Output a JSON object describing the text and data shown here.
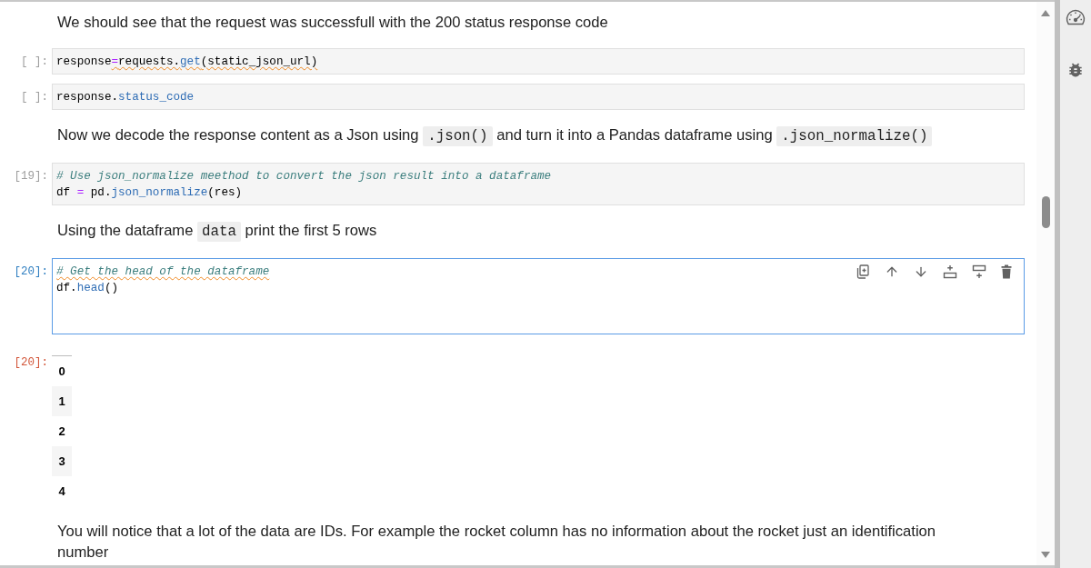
{
  "cells": [
    {
      "kind": "markdown",
      "selected": false,
      "text": [
        {
          "kind": "text",
          "text": "We should see that the request was successfull with the 200 status response code"
        }
      ]
    },
    {
      "kind": "code",
      "selected": false,
      "prompt": "[ ]:",
      "lines": [
        [
          {
            "kind": "plain",
            "text": "response",
            "flagged": false
          },
          {
            "kind": "operator",
            "text": "=",
            "flagged": true
          },
          {
            "kind": "plain",
            "text": "requests.",
            "flagged": true
          },
          {
            "kind": "attribute",
            "text": "get",
            "flagged": true
          },
          {
            "kind": "plain",
            "text": "(static_json_url)",
            "flagged": true
          }
        ]
      ]
    },
    {
      "kind": "code",
      "selected": false,
      "prompt": "[ ]:",
      "lines": [
        [
          {
            "kind": "plain",
            "text": "response.",
            "flagged": false
          },
          {
            "kind": "attribute",
            "text": "status_code",
            "flagged": false
          }
        ]
      ]
    },
    {
      "kind": "markdown",
      "selected": false,
      "text": [
        {
          "kind": "text",
          "text": "Now we decode the response content as a Json using "
        },
        {
          "kind": "code",
          "text": ".json()"
        },
        {
          "kind": "text",
          "text": " and turn it into a Pandas dataframe using "
        },
        {
          "kind": "code",
          "text": ".json_normalize()"
        }
      ]
    },
    {
      "kind": "code",
      "selected": false,
      "prompt": "[19]:",
      "lines": [
        [
          {
            "kind": "comment",
            "text": "# Use json_normalize meethod to convert the json result into a dataframe",
            "flagged": false
          }
        ],
        [
          {
            "kind": "plain",
            "text": "df ",
            "flagged": false
          },
          {
            "kind": "operator",
            "text": "=",
            "flagged": false
          },
          {
            "kind": "plain",
            "text": " pd.",
            "flagged": false
          },
          {
            "kind": "attribute",
            "text": "json_normalize",
            "flagged": false
          },
          {
            "kind": "plain",
            "text": "(res)",
            "flagged": false
          }
        ]
      ]
    },
    {
      "kind": "markdown",
      "selected": false,
      "text": [
        {
          "kind": "text",
          "text": "Using the dataframe "
        },
        {
          "kind": "code",
          "text": "data"
        },
        {
          "kind": "text",
          "text": " print the first 5 rows"
        }
      ]
    },
    {
      "kind": "code",
      "selected": true,
      "prompt": "[20]:",
      "lines": [
        [
          {
            "kind": "comment",
            "text": "# Get the head of the dataframe",
            "flagged": true
          }
        ],
        [
          {
            "kind": "plain",
            "text": "df.",
            "flagged": false
          },
          {
            "kind": "attribute",
            "text": "head",
            "flagged": false
          },
          {
            "kind": "plain",
            "text": "()",
            "flagged": false
          }
        ]
      ],
      "output": {
        "prompt": "[20]:",
        "index": [
          "0",
          "1",
          "2",
          "3",
          "4"
        ]
      }
    },
    {
      "kind": "markdown",
      "selected": false,
      "text": [
        {
          "kind": "text",
          "text": "You will notice that a lot of the data are IDs. For example the rocket column has no information about the rocket just an identification number"
        }
      ]
    }
  ]
}
